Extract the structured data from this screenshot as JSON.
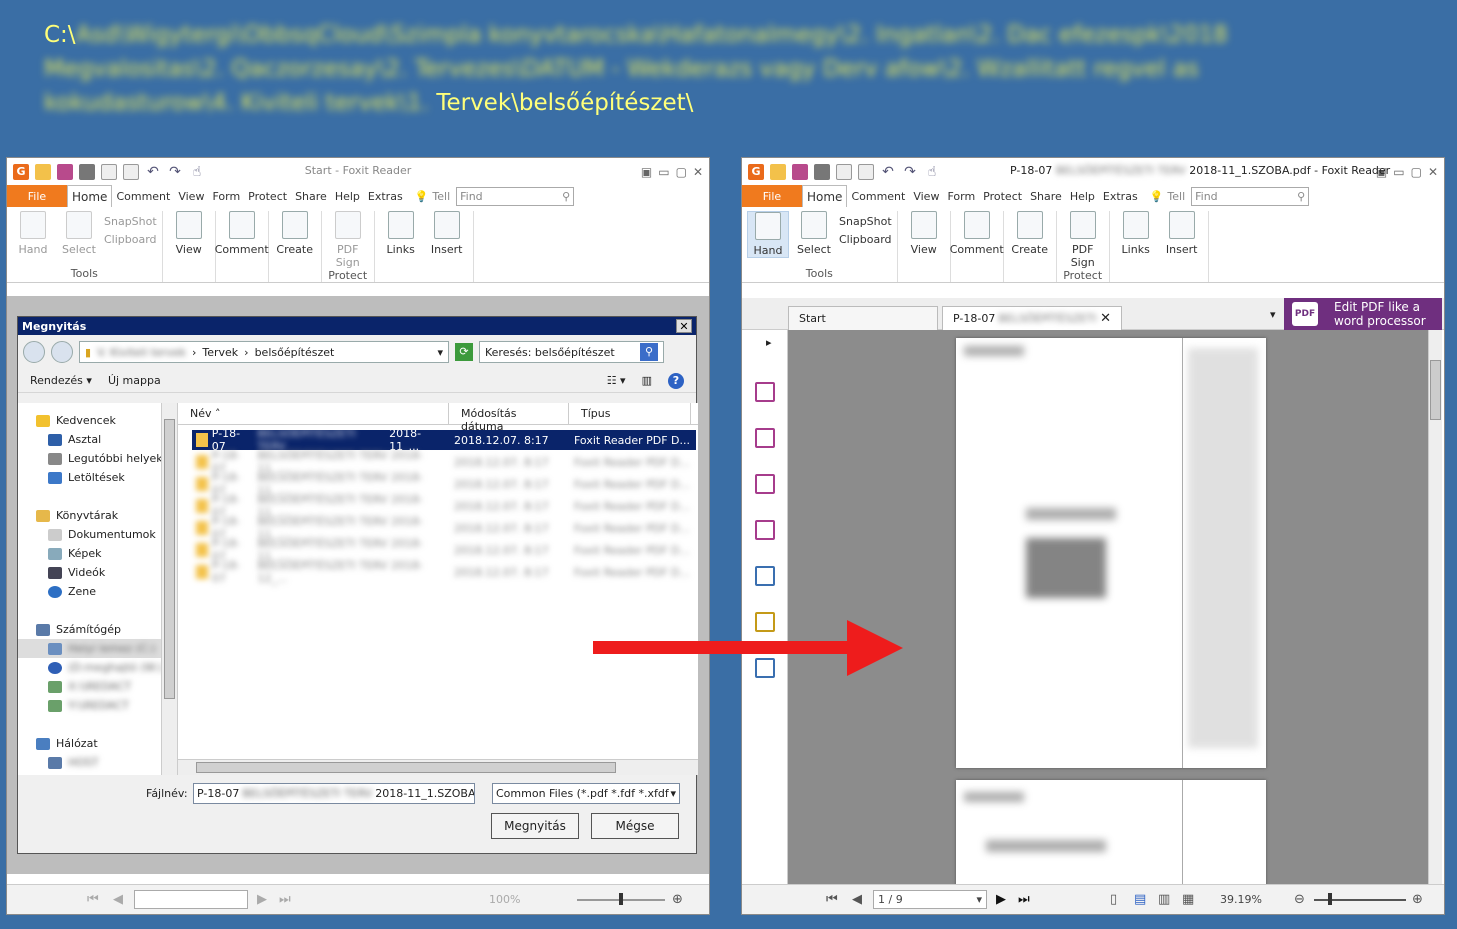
{
  "header": {
    "path_prefix": "C:\\",
    "path_blurred": "Asd\\Wigytergi\\ObbsqCloud\\Szimpla konyvtarocska\\Hafatonalmegy\\2. Ingatlan\\2. Dac efezespk\\2018 Megvalositas\\2. Qaczorzesay\\2. Tervezes\\DATUM - Wekderazs vagy Derv afow\\2. Wzallitatt regvel as kokudasturow\\4. Kiviteli tervek\\1.",
    "path_clear": " Tervek\\belsőépítészet\\"
  },
  "left_window": {
    "title": "Start - Foxit Reader",
    "menu": {
      "file": "File",
      "tabs": [
        "Home",
        "Comment",
        "View",
        "Form",
        "Protect",
        "Share",
        "Help",
        "Extras"
      ],
      "tell": "Tell",
      "find_placeholder": "Find"
    },
    "ribbon": {
      "hand": "Hand",
      "select": "Select",
      "snapshot": "SnapShot",
      "clipboard": "Clipboard",
      "tools_label": "Tools",
      "view": "View",
      "comment": "Comment",
      "create": "Create",
      "pdf_sign": "PDF",
      "pdf_sign2": "Sign",
      "protect_label": "Protect",
      "links": "Links",
      "insert": "Insert"
    },
    "status": {
      "zoom": "100%"
    }
  },
  "dialog": {
    "title": "Megnyitás",
    "breadcrumb_blur": "V. Kiviteli tervek",
    "breadcrumb": [
      "Tervek",
      "belsőépítészet"
    ],
    "search_placeholder": "Keresés: belsőépítészet",
    "toolbar": {
      "organize": "Rendezés",
      "new_folder": "Új mappa"
    },
    "nav": {
      "favorites": "Kedvencek",
      "desktop": "Asztal",
      "recent": "Legutóbbi helyek",
      "downloads": "Letöltések",
      "libraries": "Könyvtárak",
      "documents": "Dokumentumok",
      "pictures": "Képek",
      "videos": "Videók",
      "music": "Zene",
      "computer": "Számítógép",
      "drive_c": "Helyi lemez (C:)",
      "drive_d": "(D:meghajtó (W:)",
      "drive_x": "X:\\\\REDACT",
      "drive_y": "Y:\\\\REDACT",
      "network": "Hálózat",
      "net_host": "HOST"
    },
    "columns": {
      "name": "Név",
      "modified": "Módosítás dátuma",
      "type": "Típus"
    },
    "files": [
      {
        "name_prefix": "P-18-07",
        "name_blur": "BELSŐÉPÍTÉSZETI TERV",
        "name_suffix": "2018-11_...",
        "date": "2018.12.07. 8:17",
        "type": "Foxit Reader PDF D..."
      },
      {
        "name_prefix": "P-18-07",
        "name_blur": "BELSŐÉPÍTÉSZETI TERV 2018-11_...",
        "name_suffix": "",
        "date": "2018.12.07. 8:17",
        "type": "Foxit Reader PDF D..."
      },
      {
        "name_prefix": "P-18-07",
        "name_blur": "BELSŐÉPÍTÉSZETI TERV 2018-11_...",
        "name_suffix": "",
        "date": "2018.12.07. 8:17",
        "type": "Foxit Reader PDF D..."
      },
      {
        "name_prefix": "P-18-07",
        "name_blur": "BELSŐÉPÍTÉSZETI TERV 2018-11_...",
        "name_suffix": "",
        "date": "2018.12.07. 8:17",
        "type": "Foxit Reader PDF D..."
      },
      {
        "name_prefix": "P-18-07",
        "name_blur": "BELSŐÉPÍTÉSZETI TERV 2018-11_...",
        "name_suffix": "",
        "date": "2018.12.07. 8:17",
        "type": "Foxit Reader PDF D..."
      },
      {
        "name_prefix": "P-18-07",
        "name_blur": "BELSŐÉPÍTÉSZETI TERV 2018-11_...",
        "name_suffix": "",
        "date": "2018.12.07. 8:17",
        "type": "Foxit Reader PDF D..."
      },
      {
        "name_prefix": "P-18-07",
        "name_blur": "BELSŐÉPÍTÉSZETI TERV 2018-12_...",
        "name_suffix": "",
        "date": "2018.12.07. 8:17",
        "type": "Foxit Reader PDF D..."
      }
    ],
    "filename_label": "Fájlnév:",
    "filename_prefix": "P-18-07",
    "filename_blur": "BELSŐÉPÍTÉSZETI TERV",
    "filename_suffix": "2018-11_1.SZOBA",
    "filetype": "Common Files (*.pdf *.fdf *.xfdf",
    "open_button": "Megnyitás",
    "cancel_button": "Mégse"
  },
  "right_window": {
    "title_prefix": "P-18-07",
    "title_blur": "BELSŐÉPÍTÉSZETI TERV",
    "title_suffix": "2018-11_1.SZOBA.pdf - Foxit Reader",
    "tab_start": "Start",
    "tab_doc": "P-18-07",
    "tab_doc_blur": "BELSŐÉPÍTÉSZETI",
    "promo": "Edit PDF like a word processor",
    "promo_badge": "PDF",
    "page_indicator": "1 / 9",
    "zoom": "39.19%"
  },
  "colors": {
    "desktop": "#3a6ea5",
    "foxit_orange": "#f07a1e",
    "path_yellow": "#ffff66",
    "arrow": "#ee1c1c"
  }
}
